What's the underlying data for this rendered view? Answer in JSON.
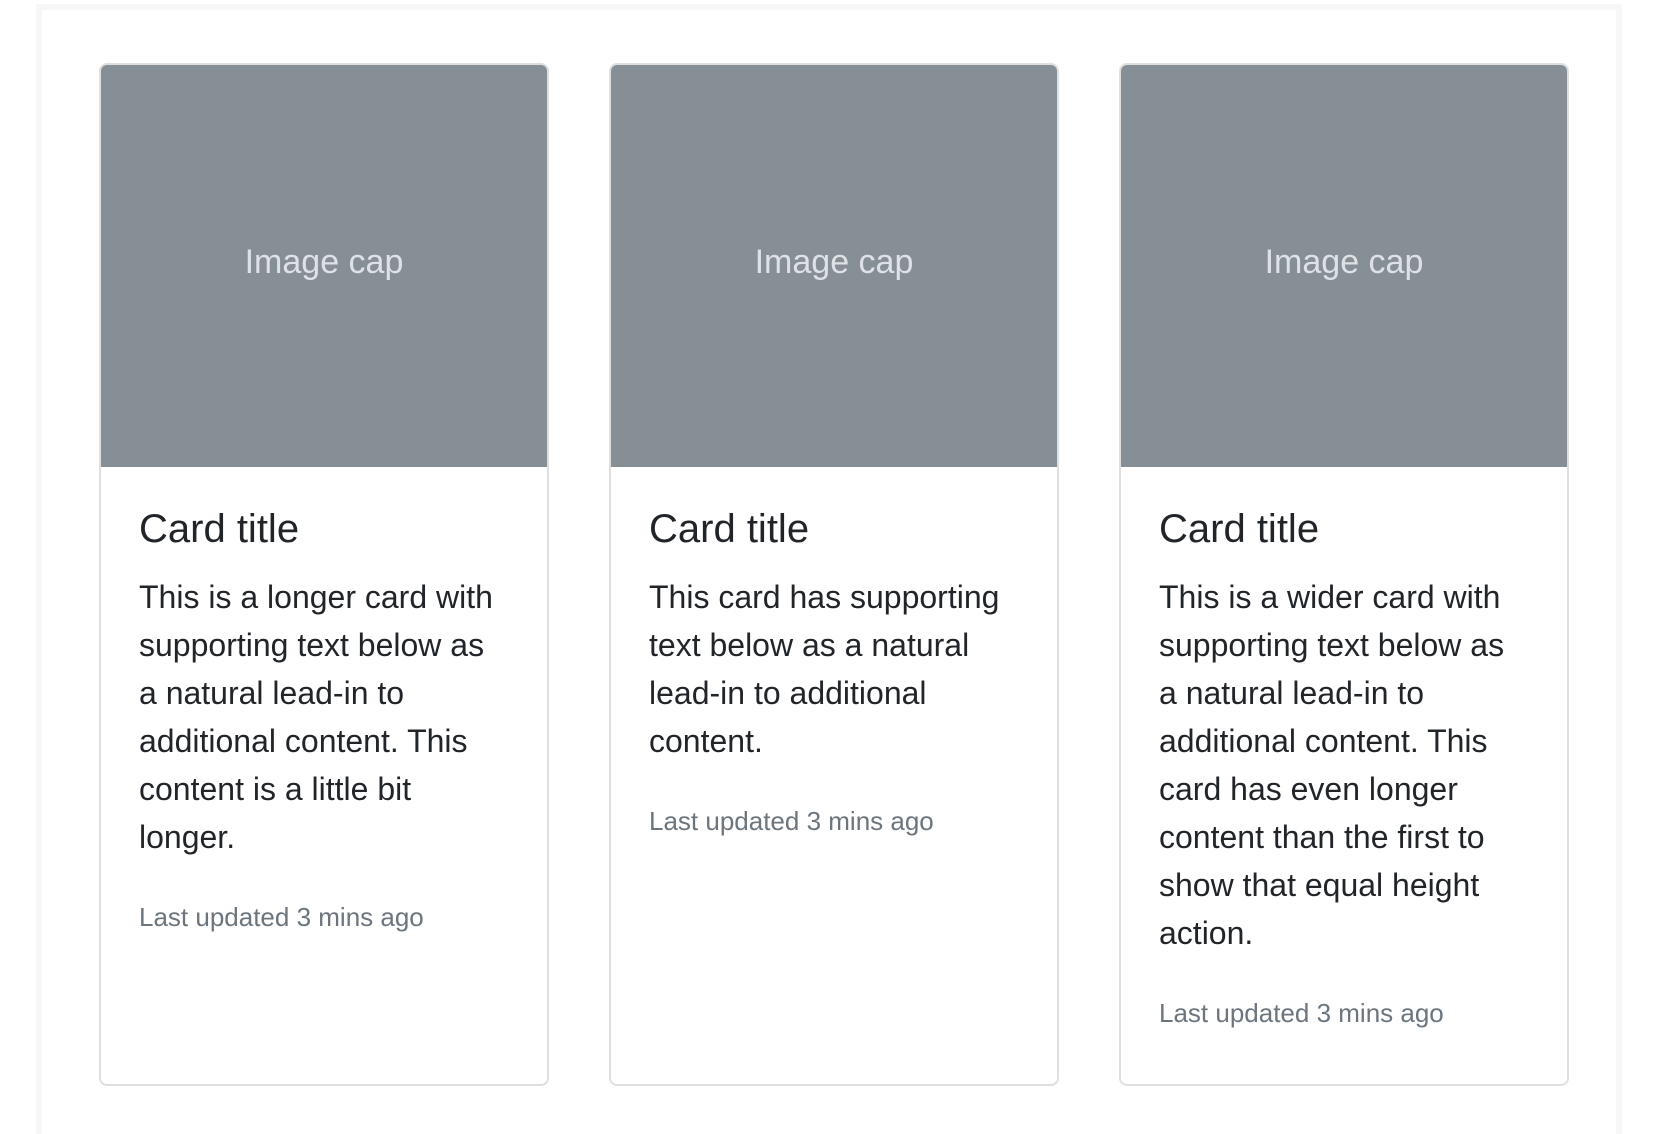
{
  "cards": [
    {
      "image_cap": "Image cap",
      "title": "Card title",
      "text": "This is a longer card with supporting text below as a natural lead-in to additional content. This content is a little bit longer.",
      "meta": "Last updated 3 mins ago"
    },
    {
      "image_cap": "Image cap",
      "title": "Card title",
      "text": "This card has supporting text below as a natural lead-in to additional content.",
      "meta": "Last updated 3 mins ago"
    },
    {
      "image_cap": "Image cap",
      "title": "Card title",
      "text": "This is a wider card with supporting text below as a natural lead-in to additional content. This card has even longer content than the first to show that equal height action.",
      "meta": "Last updated 3 mins ago"
    }
  ],
  "colors": {
    "image_cap_bg": "#868e96",
    "image_cap_text": "#dee2e6",
    "muted_text": "#6c757d",
    "card_border": "#dfdfdf"
  }
}
